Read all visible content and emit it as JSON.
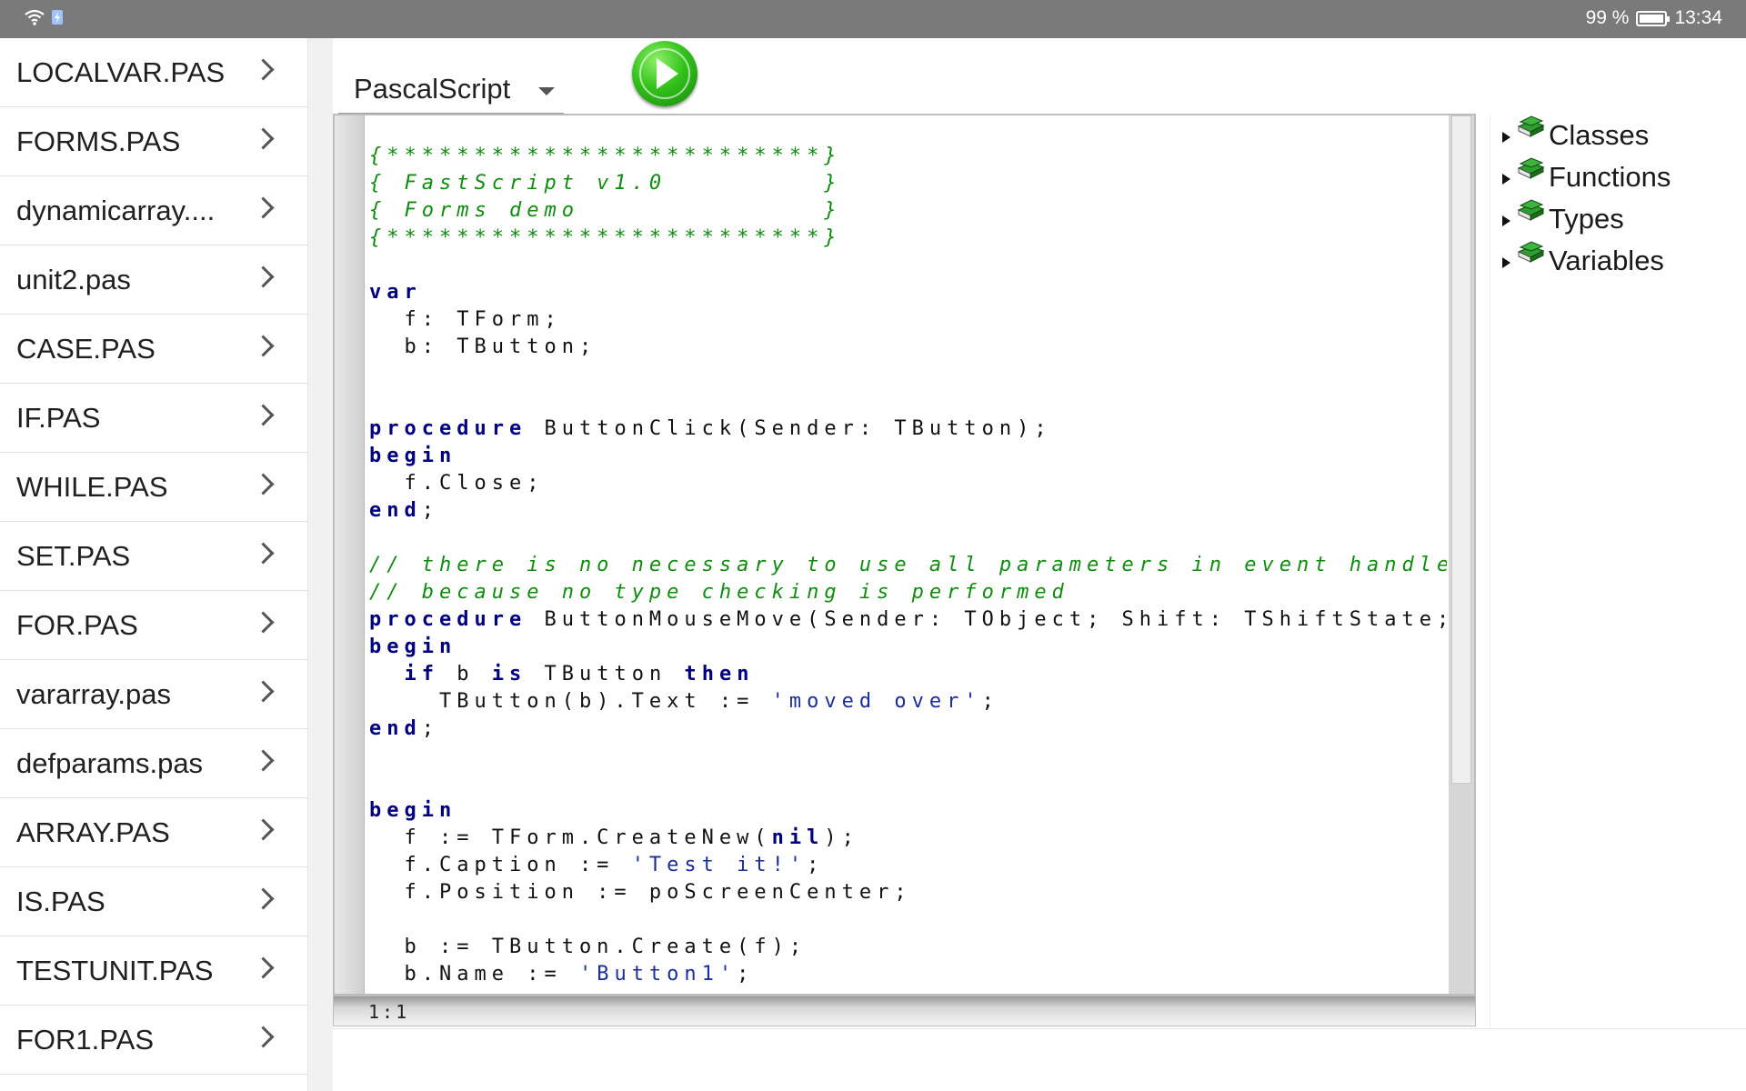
{
  "status_bar": {
    "battery_text": "99 %",
    "battery_level": 0.99,
    "time": "13:34",
    "icons": [
      "wifi-icon",
      "charging-icon",
      "battery-icon"
    ]
  },
  "file_list": [
    "LOCALVAR.PAS",
    "FORMS.PAS",
    "dynamicarray....",
    "unit2.pas",
    "CASE.PAS",
    "IF.PAS",
    "WHILE.PAS",
    "SET.PAS",
    "FOR.PAS",
    "vararray.pas",
    "defparams.pas",
    "ARRAY.PAS",
    "IS.PAS",
    "TESTUNIT.PAS",
    "FOR1.PAS"
  ],
  "toolbar": {
    "language": "PascalScript",
    "run_icon": "play-icon"
  },
  "editor": {
    "cursor_position": "1:1",
    "lines": [
      [
        {
          "t": "{*************************}",
          "s": "com"
        }
      ],
      [
        {
          "t": "{ FastScript v1.0         }",
          "s": "com"
        }
      ],
      [
        {
          "t": "{ Forms demo              }",
          "s": "com"
        }
      ],
      [
        {
          "t": "{*************************}",
          "s": "com"
        }
      ],
      [],
      [
        {
          "t": "var",
          "s": "kw"
        }
      ],
      [
        {
          "t": "  f: TForm;",
          "s": ""
        }
      ],
      [
        {
          "t": "  b: TButton;",
          "s": ""
        }
      ],
      [],
      [],
      [
        {
          "t": "procedure",
          "s": "kw"
        },
        {
          "t": " ButtonClick(Sender: TButton);",
          "s": ""
        }
      ],
      [
        {
          "t": "begin",
          "s": "kw"
        }
      ],
      [
        {
          "t": "  f.Close;",
          "s": ""
        }
      ],
      [
        {
          "t": "end",
          "s": "kw"
        },
        {
          "t": ";",
          "s": ""
        }
      ],
      [],
      [
        {
          "t": "// there is no necessary to use all parameters in event handlers",
          "s": "com"
        }
      ],
      [
        {
          "t": "// because no type checking is performed",
          "s": "com"
        }
      ],
      [
        {
          "t": "procedure",
          "s": "kw"
        },
        {
          "t": " ButtonMouseMove(Sender: TObject; Shift: TShiftState; X, Y: Si",
          "s": ""
        }
      ],
      [
        {
          "t": "begin",
          "s": "kw"
        }
      ],
      [
        {
          "t": "  ",
          "s": ""
        },
        {
          "t": "if",
          "s": "kw"
        },
        {
          "t": " b ",
          "s": ""
        },
        {
          "t": "is",
          "s": "kw"
        },
        {
          "t": " TButton ",
          "s": ""
        },
        {
          "t": "then",
          "s": "kw"
        }
      ],
      [
        {
          "t": "    TButton(b).Text := ",
          "s": ""
        },
        {
          "t": "'moved over'",
          "s": "str"
        },
        {
          "t": ";",
          "s": ""
        }
      ],
      [
        {
          "t": "end",
          "s": "kw"
        },
        {
          "t": ";",
          "s": ""
        }
      ],
      [],
      [],
      [
        {
          "t": "begin",
          "s": "kw"
        }
      ],
      [
        {
          "t": "  f := TForm.CreateNew(",
          "s": ""
        },
        {
          "t": "nil",
          "s": "kw"
        },
        {
          "t": ");",
          "s": ""
        }
      ],
      [
        {
          "t": "  f.Caption := ",
          "s": ""
        },
        {
          "t": "'Test it!'",
          "s": "str"
        },
        {
          "t": ";",
          "s": ""
        }
      ],
      [
        {
          "t": "  f.Position := poScreenCenter;",
          "s": ""
        }
      ],
      [],
      [
        {
          "t": "  b := TButton.Create(f);",
          "s": ""
        }
      ],
      [
        {
          "t": "  b.Name := ",
          "s": ""
        },
        {
          "t": "'Button1'",
          "s": "str"
        },
        {
          "t": ";",
          "s": ""
        }
      ]
    ]
  },
  "tree": [
    {
      "label": "Classes",
      "icon": "book-icon"
    },
    {
      "label": "Functions",
      "icon": "book-icon"
    },
    {
      "label": "Types",
      "icon": "book-icon"
    },
    {
      "label": "Variables",
      "icon": "book-icon"
    }
  ],
  "colors": {
    "comment": "#118c11",
    "keyword": "#000080",
    "string": "#1a2d9a",
    "status_bar": "#7a7a7a",
    "run_button": "#33c21b"
  }
}
